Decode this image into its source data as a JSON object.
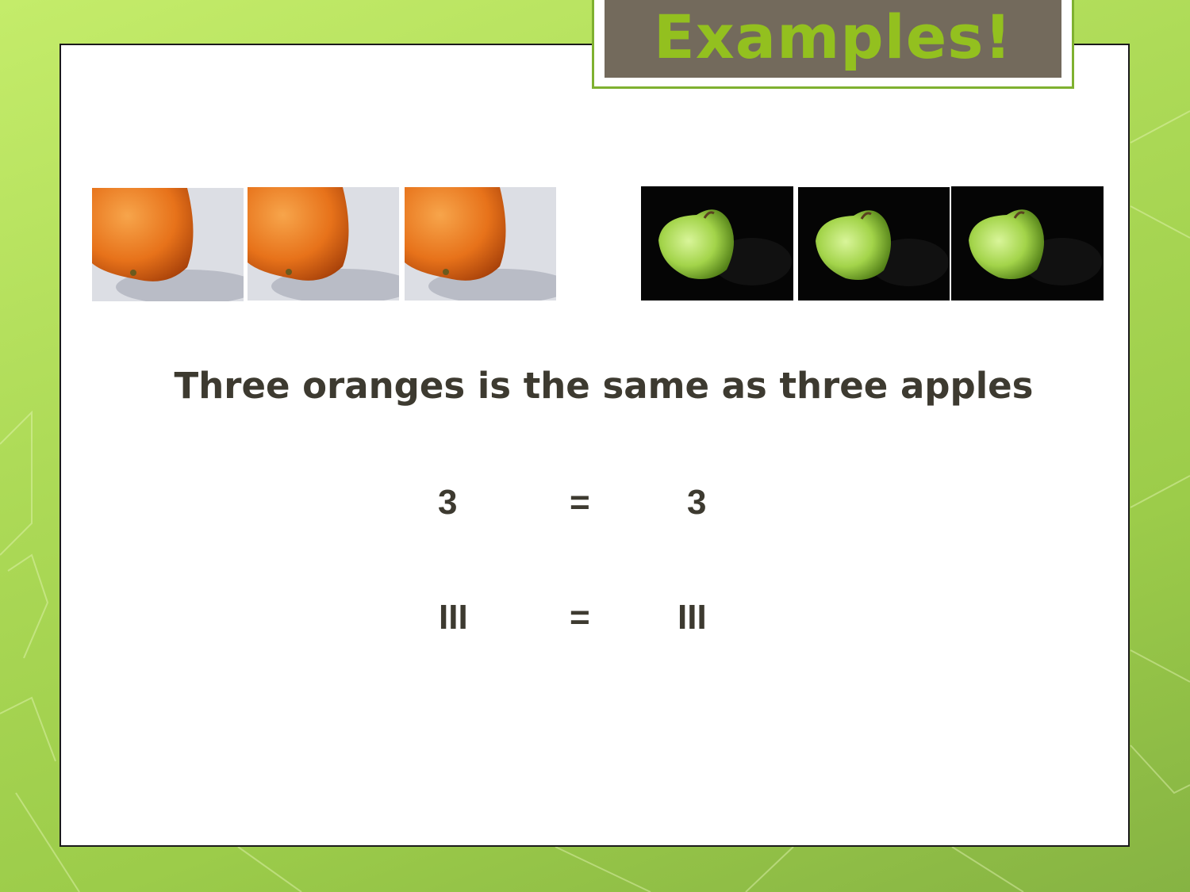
{
  "slide": {
    "title": "Examples!",
    "caption": "Three oranges is the same as three apples",
    "equations": [
      {
        "left": "3",
        "operator": "=",
        "right": "3"
      },
      {
        "left": "III",
        "operator": "=",
        "right": "III"
      }
    ]
  },
  "images": {
    "oranges": [
      "orange-photo",
      "orange-photo",
      "orange-photo"
    ],
    "apples": [
      "green-apple-photo",
      "green-apple-photo",
      "green-apple-photo"
    ]
  },
  "colors": {
    "background": "#a8d655",
    "title_box": "#736a5c",
    "title_text": "#93c01f",
    "body_text": "#3d3a30",
    "accent_border": "#7fb130"
  }
}
